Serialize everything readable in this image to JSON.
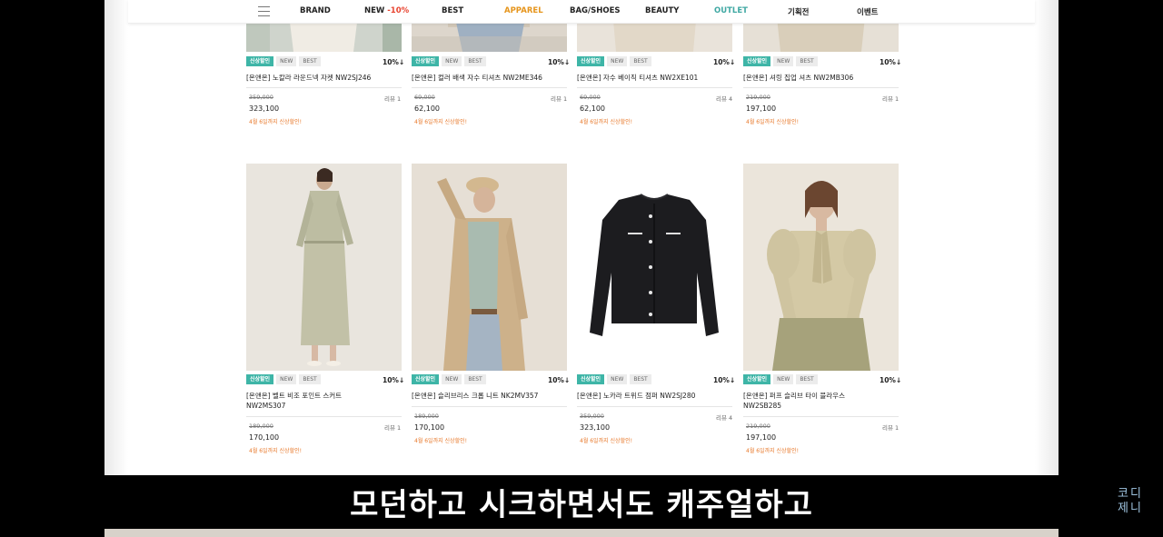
{
  "nav": {
    "items": [
      {
        "label": "BRAND"
      },
      {
        "label": "NEW ",
        "accent": "-10%"
      },
      {
        "label": "BEST"
      },
      {
        "label": "APPAREL"
      },
      {
        "label": "BAG/SHOES"
      },
      {
        "label": "BEAUTY"
      },
      {
        "label": "OUTLET"
      },
      {
        "label": "기획전"
      },
      {
        "label": "이벤트"
      }
    ],
    "colors": {
      "apparel": "#e6951c",
      "outlet": "#3fa8a3",
      "sale_accent": "#e8432f"
    }
  },
  "tags": {
    "sale": "신상할인",
    "new": "NEW",
    "best": "BEST"
  },
  "row1": [
    {
      "name": "[온앤온] 노칼라 라운드넥 자켓 NW2SJ246",
      "discount": "10%↓",
      "orig": "359,000",
      "reviews": "리뷰 1",
      "price": "323,100",
      "promo": "4월 6일까지 신상할인!"
    },
    {
      "name": "[온앤온] 컬러 배색 자수 티셔츠 NW2ME346",
      "discount": "10%↓",
      "orig": "69,000",
      "reviews": "리뷰 1",
      "price": "62,100",
      "promo": "4월 6일까지 신상할인!"
    },
    {
      "name": "[온앤온] 자수 베이직 티셔츠 NW2XE101",
      "discount": "10%↓",
      "orig": "69,000",
      "reviews": "리뷰 4",
      "price": "62,100",
      "promo": "4월 6일까지 신상할인!"
    },
    {
      "name": "[온앤온] 셔링 집업 셔츠 NW2MB306",
      "discount": "10%↓",
      "orig": "219,000",
      "reviews": "리뷰 1",
      "price": "197,100",
      "promo": "4월 6일까지 신상할인!"
    }
  ],
  "row2": [
    {
      "name_line1": "[온앤온] 벨트 비조 포인트 스커트",
      "name_line2": "NW2MS307",
      "discount": "10%↓",
      "orig": "189,000",
      "reviews": "리뷰 1",
      "price": "170,100",
      "promo": "4월 6일까지 신상할인!"
    },
    {
      "name_line1": "[온앤온] 슬리브리스 크롭 니트 NK2MV357",
      "name_line2": "",
      "discount": "10%↓",
      "orig": "189,000",
      "reviews": "",
      "price": "170,100",
      "promo": "4월 6일까지 신상할인!"
    },
    {
      "name_line1": "[온앤온] 노카라 트위드 점퍼 NW2SJ280",
      "name_line2": "",
      "discount": "10%↓",
      "orig": "359,000",
      "reviews": "리뷰 4",
      "price": "323,100",
      "promo": "4월 6일까지 신상할인!"
    },
    {
      "name_line1": "[온앤온] 퍼프 슬리브 타이 블라우스",
      "name_line2": "NW2SB285",
      "discount": "10%↓",
      "orig": "219,000",
      "reviews": "리뷰 1",
      "price": "197,100",
      "promo": "4월 6일까지 신상할인!"
    }
  ],
  "subtitle": "모던하고 시크하면서도 캐주얼하고",
  "watermark": {
    "line1": "코디",
    "line2": "제니"
  }
}
